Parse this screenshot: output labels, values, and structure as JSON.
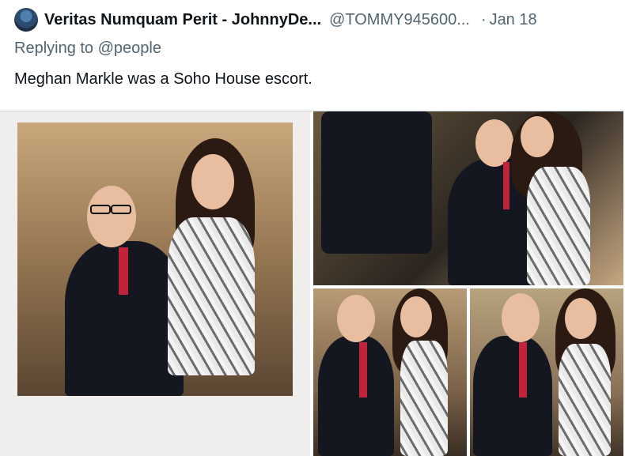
{
  "tweet": {
    "display_name": "Veritas Numquam Perit - JohnnyDe...",
    "handle": "@TOMMY945600...",
    "separator": "·",
    "date": "Jan 18",
    "reply_prefix": "Replying to",
    "reply_mention": "@people",
    "text": "Meghan Markle was a Soho House escort."
  },
  "media": {
    "count": 4
  }
}
